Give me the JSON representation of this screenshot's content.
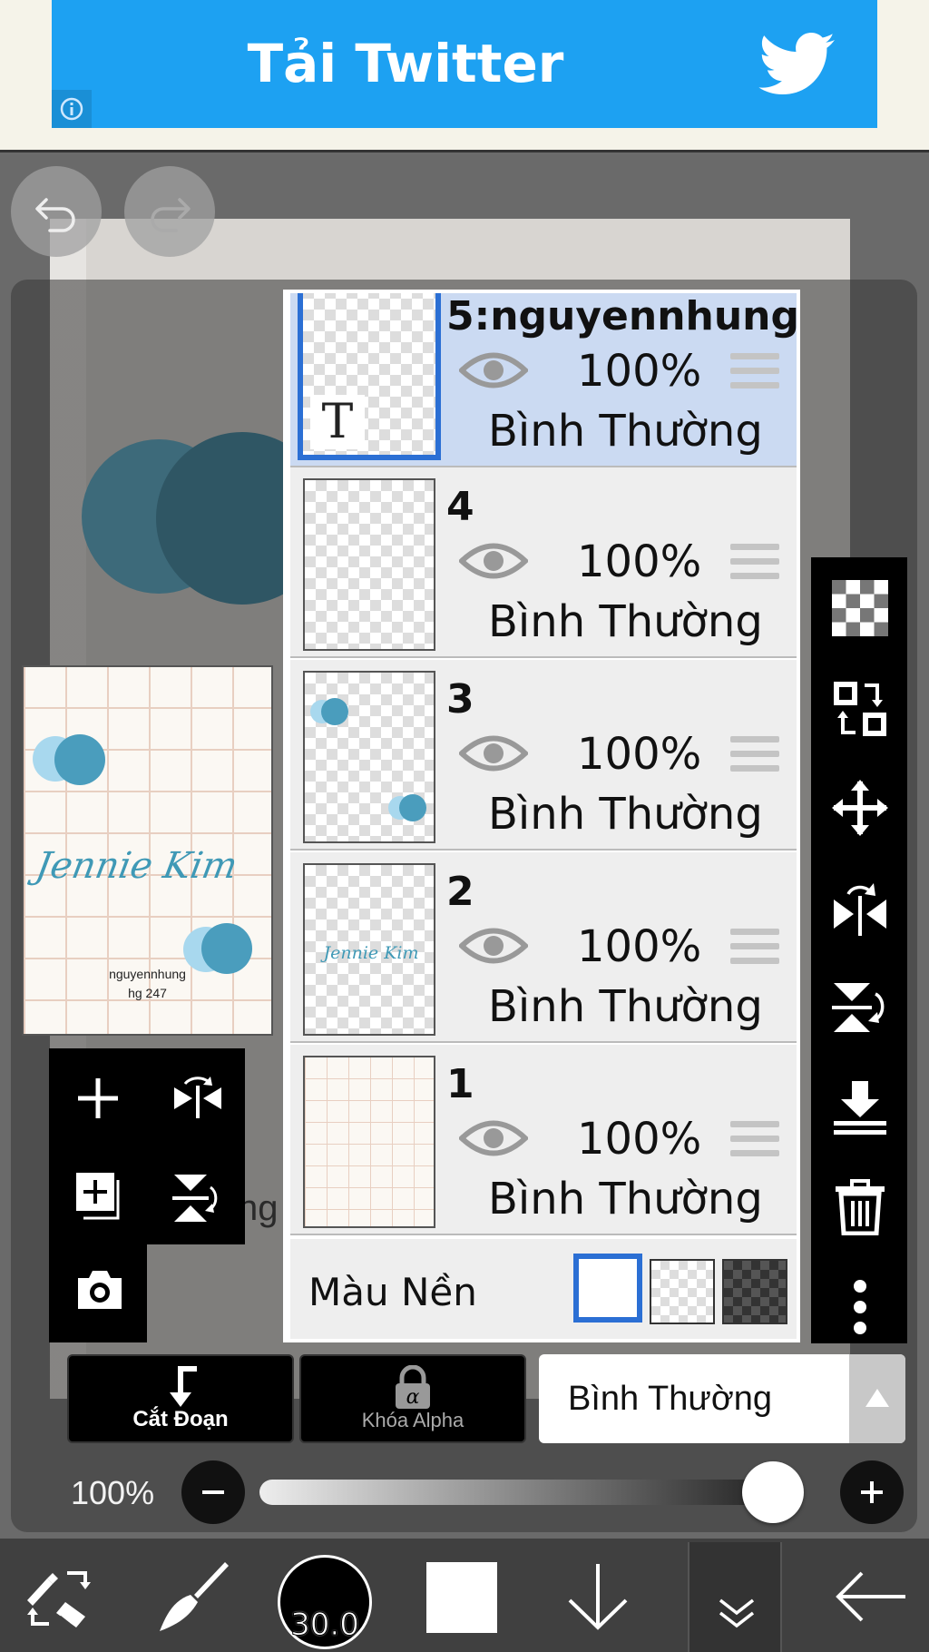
{
  "ad": {
    "text": "Tải Twitter",
    "bird_icon": "twitter-bird-icon",
    "info_icon": "info-icon",
    "color": "#1da1f2"
  },
  "history": {
    "undo_icon": "undo-icon",
    "redo_icon": "redo-icon"
  },
  "preview": {
    "title": "Jennie Kim",
    "name": "nguyennhung",
    "subname": "hg 247"
  },
  "canvas": {
    "partial_text": "ng"
  },
  "left_tools": [
    {
      "icon": "add-layer-icon"
    },
    {
      "icon": "flip-horizontal-icon"
    },
    {
      "icon": "add-copy-layer-icon"
    },
    {
      "icon": "flip-vertical-icon"
    },
    {
      "icon": "camera-icon"
    }
  ],
  "layers": [
    {
      "name": "5:nguyennhung",
      "opacity": "100%",
      "mode": "Bình Thường",
      "selected": true,
      "thumb_text": "T"
    },
    {
      "name": "4",
      "opacity": "100%",
      "mode": "Bình Thường",
      "selected": false
    },
    {
      "name": "3",
      "opacity": "100%",
      "mode": "Bình Thường",
      "selected": false
    },
    {
      "name": "2",
      "opacity": "100%",
      "mode": "Bình Thường",
      "selected": false,
      "thumb_text": "Jennie Kim"
    },
    {
      "name": "1",
      "opacity": "100%",
      "mode": "Bình Thường",
      "selected": false
    }
  ],
  "background": {
    "label": "Màu Nền",
    "options": [
      "white",
      "transparent",
      "dark-checker"
    ],
    "selected": "white",
    "accent": "#2b6fd4"
  },
  "right_tools": [
    {
      "icon": "transparency-checker-icon"
    },
    {
      "icon": "swap-layers-icon"
    },
    {
      "icon": "move-icon"
    },
    {
      "icon": "flip-layer-horizontal-icon"
    },
    {
      "icon": "flip-layer-vertical-icon"
    },
    {
      "icon": "merge-down-icon"
    },
    {
      "icon": "trash-icon"
    },
    {
      "icon": "more-vertical-icon"
    }
  ],
  "actions": {
    "clipping_label": "Cắt Đoạn",
    "alpha_lock_label": "Khóa Alpha",
    "blend_mode": "Bình Thường"
  },
  "opacity_slider": {
    "label": "100%",
    "value": 1.0
  },
  "toolbar": {
    "brush_size": "30.0",
    "tools": [
      "tool-switch-icon",
      "brush-icon",
      "brush-size-indicator",
      "color-swatch",
      "arrow-down-icon",
      "layers-icon",
      "back-arrow-icon"
    ],
    "color": "#ffffff"
  }
}
